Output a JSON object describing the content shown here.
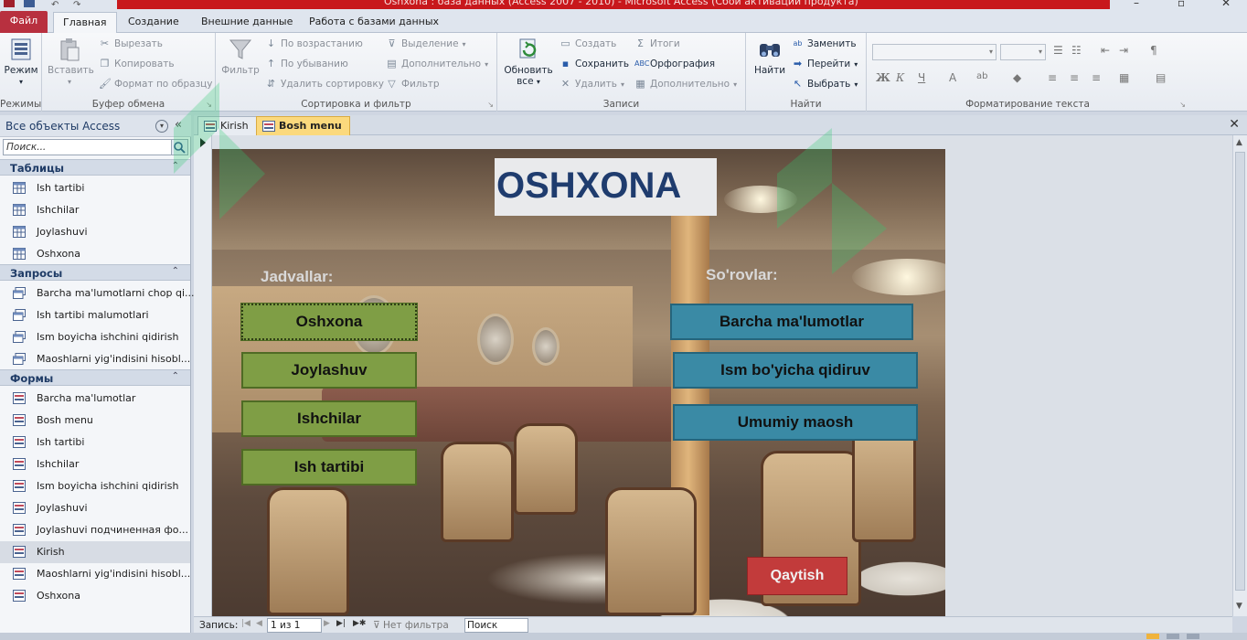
{
  "window": {
    "title": "Oshxona : база данных (Access 2007 - 2010) - Microsoft Access (Сбой активации продукта)"
  },
  "ribbon_tabs": [
    "Файл",
    "Главная",
    "Создание",
    "Внешние данные",
    "Работа с базами данных"
  ],
  "ribbon": {
    "views": {
      "mode_label": "Режим",
      "group_label": "Режимы"
    },
    "clipboard": {
      "paste_label": "Вставить",
      "cut_label": "Вырезать",
      "copy_label": "Копировать",
      "format_painter_label": "Формат по образцу",
      "group_label": "Буфер обмена"
    },
    "sort_filter": {
      "filter_label": "Фильтр",
      "ascending_label": "По возрастанию",
      "descending_label": "По убыванию",
      "remove_sort_label": "Удалить сортировку",
      "selection_label": "Выделение",
      "advanced_label": "Дополнительно",
      "toggle_filter_label": "Фильтр",
      "group_label": "Сортировка и фильтр"
    },
    "records": {
      "refresh_label": "Обновить все",
      "new_label": "Создать",
      "save_label": "Сохранить",
      "delete_label": "Удалить",
      "totals_label": "Итоги",
      "spelling_label": "Орфография",
      "more_label": "Дополнительно",
      "group_label": "Записи"
    },
    "find": {
      "find_label": "Найти",
      "replace_label": "Заменить",
      "goto_label": "Перейти",
      "select_label": "Выбрать",
      "group_label": "Найти"
    },
    "text_format": {
      "bold": "Ж",
      "italic": "К",
      "underline": "Ч",
      "group_label": "Форматирование текста"
    }
  },
  "nav_pane": {
    "header": "Все объекты Access",
    "search_placeholder": "Поиск...",
    "sections": [
      {
        "title": "Таблицы",
        "items": [
          "Ish tartibi",
          "Ishchilar",
          "Joylashuvi",
          "Oshxona"
        ]
      },
      {
        "title": "Запросы",
        "items": [
          "Barcha ma'lumotlarni chop qi...",
          "Ish tartibi malumotlari",
          "Ism boyicha ishchini qidirish",
          "Maoshlarni yig'indisini hisobl..."
        ]
      },
      {
        "title": "Формы",
        "items": [
          "Barcha ma'lumotlar",
          "Bosh menu",
          "Ish tartibi",
          "Ishchilar",
          "Ism boyicha ishchini qidirish",
          "Joylashuvi",
          "Joylashuvi подчиненная фо...",
          "Kirish",
          "Maoshlarni yig'indisini hisobl...",
          "Oshxona"
        ]
      }
    ],
    "selected_item": "Kirish"
  },
  "doc_tabs": [
    {
      "label": "Kirish",
      "active": false
    },
    {
      "label": "Bosh menu",
      "active": true
    }
  ],
  "form": {
    "title": "OSHXONA",
    "tables_label": "Jadvallar:",
    "queries_label": "So'rovlar:",
    "table_buttons": [
      "Oshxona",
      "Joylashuv",
      "Ishchilar",
      "Ish tartibi"
    ],
    "query_buttons": [
      "Barcha ma'lumotlar",
      "Ism bo'yicha qidiruv",
      "Umumiy maosh"
    ],
    "back_button": "Qaytish",
    "colors": {
      "green": "#7f9e45",
      "teal": "#3a8aa5",
      "red": "#c23b3b",
      "title": "#1f3c6e"
    }
  },
  "record_nav": {
    "label": "Запись:",
    "position": "1 из 1",
    "filter_label": "Нет фильтра",
    "search_label": "Поиск"
  }
}
